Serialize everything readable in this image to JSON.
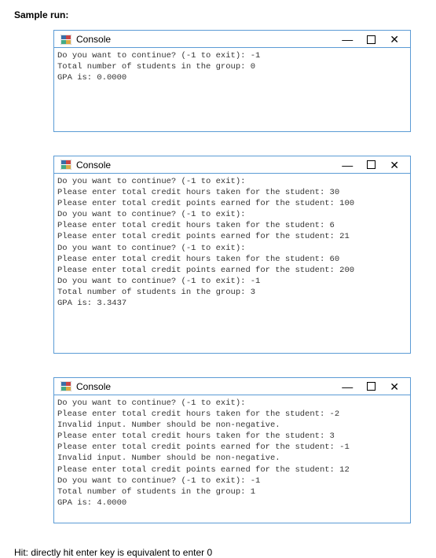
{
  "heading": "Sample run:",
  "window_title": "Console",
  "controls": {
    "minimize": "—",
    "close": "✕"
  },
  "consoles": [
    {
      "lines": [
        "Do you want to continue? (-1 to exit): -1",
        "Total number of students in the group: 0",
        "GPA is: 0.0000"
      ]
    },
    {
      "lines": [
        "Do you want to continue? (-1 to exit):",
        "Please enter total credit hours taken for the student: 30",
        "Please enter total credit points earned for the student: 100",
        "Do you want to continue? (-1 to exit):",
        "Please enter total credit hours taken for the student: 6",
        "Please enter total credit points earned for the student: 21",
        "Do you want to continue? (-1 to exit):",
        "Please enter total credit hours taken for the student: 60",
        "Please enter total credit points earned for the student: 200",
        "Do you want to continue? (-1 to exit): -1",
        "Total number of students in the group: 3",
        "GPA is: 3.3437"
      ]
    },
    {
      "lines": [
        "Do you want to continue? (-1 to exit):",
        "Please enter total credit hours taken for the student: -2",
        "Invalid input. Number should be non-negative.",
        "Please enter total credit hours taken for the student: 3",
        "Please enter total credit points earned for the student: -1",
        "Invalid input. Number should be non-negative.",
        "Please enter total credit points earned for the student: 12",
        "Do you want to continue? (-1 to exit): -1",
        "Total number of students in the group: 1",
        "GPA is: 4.0000"
      ]
    }
  ],
  "hint": "Hit: directly hit enter key is equivalent to enter 0"
}
